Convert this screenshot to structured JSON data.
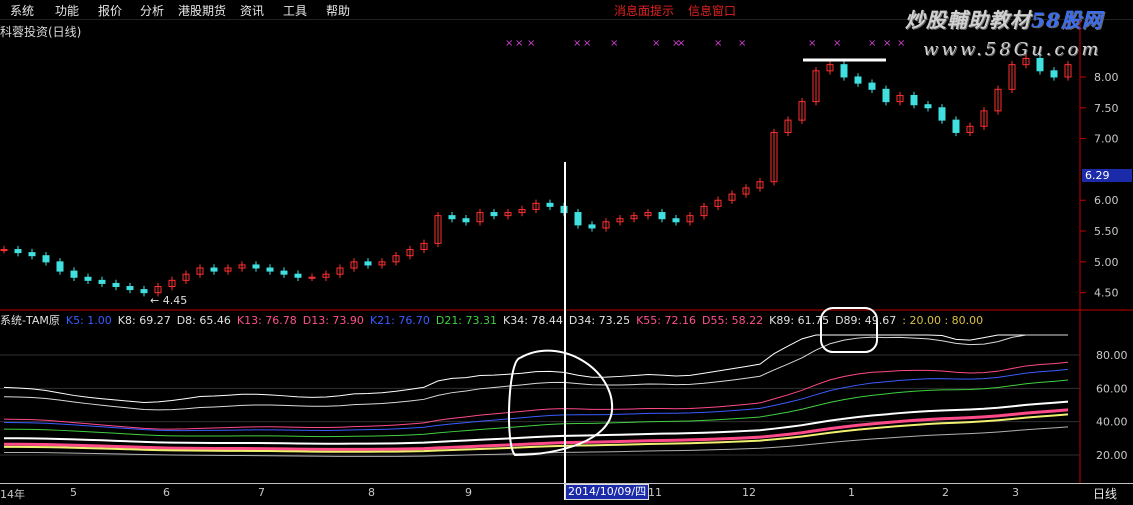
{
  "menu": {
    "items": [
      "系统",
      "功能",
      "报价",
      "分析",
      "港股期货",
      "资讯",
      "工具",
      "帮助"
    ],
    "red_items": [
      "消息面提示",
      "信息窗口"
    ]
  },
  "chart_title": "科蓉投资(日线)",
  "watermark": {
    "line1_pre": "炒股輔助教材",
    "line1_brand": "58股网",
    "line2": "www.58Gu.com"
  },
  "main_axis_labels": [
    "8.00",
    "7.50",
    "7.00",
    "6.00",
    "5.50",
    "5.00",
    "4.50"
  ],
  "current_price": "6.29",
  "low_annotation": "4.45",
  "indicator_caption": [
    {
      "text": "系统-TAM原",
      "color": "#e0e0e0"
    },
    {
      "text": "K5: 1.00",
      "color": "#3a5cff"
    },
    {
      "text": "K8: 69.27",
      "color": "#e0e0e0"
    },
    {
      "text": "D8: 65.46",
      "color": "#e0e0e0"
    },
    {
      "text": "K13: 76.78",
      "color": "#ff5090"
    },
    {
      "text": "D13: 73.90",
      "color": "#ff5090"
    },
    {
      "text": "K21: 76.70",
      "color": "#3a5cff"
    },
    {
      "text": "D21: 73.31",
      "color": "#40d040"
    },
    {
      "text": "K34: 78.44",
      "color": "#e0e0e0"
    },
    {
      "text": "D34: 73.25",
      "color": "#e0e0e0"
    },
    {
      "text": "K55: 72.16",
      "color": "#ff5090"
    },
    {
      "text": "D55: 58.22",
      "color": "#ff5090"
    },
    {
      "text": "K89: 61.75",
      "color": "#e0e0e0"
    },
    {
      "text": "D89: 49.67",
      "color": "#e0e0e0"
    },
    {
      "text": ": 20.00 : 80.00",
      "color": "#d8c040"
    }
  ],
  "indicator_axis_labels": [
    "80.00",
    "60.00",
    "40.00",
    "20.00"
  ],
  "bottom_axis_labels": [
    "14年",
    "5",
    "6",
    "7",
    "8",
    "9",
    "11",
    "12",
    "1",
    "2",
    "3"
  ],
  "date_badge": "2014/10/09/四",
  "period": "日线",
  "colors": {
    "up": "#ff3030",
    "down": "#40e0e0",
    "axis": "#c00000",
    "cursor": "#ffffff"
  },
  "chart_data": {
    "type": "candlestick",
    "title": "科蓉投资(日线)",
    "price_ylim": [
      4.3,
      8.6
    ],
    "price_ticks": [
      4.5,
      5.0,
      5.5,
      6.0,
      7.0,
      7.5,
      8.0
    ],
    "current_price": 6.29,
    "low_marker": 4.45,
    "close_series_approx": [
      5.2,
      5.15,
      5.1,
      5.0,
      4.85,
      4.75,
      4.7,
      4.65,
      4.6,
      4.55,
      4.5,
      4.6,
      4.7,
      4.8,
      4.9,
      4.85,
      4.9,
      4.95,
      4.9,
      4.85,
      4.8,
      4.75,
      4.75,
      4.8,
      4.9,
      5.0,
      4.95,
      5.0,
      5.1,
      5.2,
      5.3,
      5.75,
      5.7,
      5.65,
      5.8,
      5.75,
      5.8,
      5.85,
      5.95,
      5.9,
      5.8,
      5.6,
      5.55,
      5.65,
      5.7,
      5.75,
      5.8,
      5.7,
      5.65,
      5.75,
      5.9,
      6.0,
      6.1,
      6.2,
      6.3,
      7.1,
      7.3,
      7.6,
      8.1,
      8.2,
      8.0,
      7.9,
      7.8,
      7.6,
      7.7,
      7.55,
      7.5,
      7.3,
      7.1,
      7.2,
      7.45,
      7.8,
      8.2,
      8.3,
      8.1,
      8.0,
      8.2
    ],
    "indicator_ylim": [
      5,
      95
    ],
    "indicator_ticks": [
      80,
      60,
      40,
      20
    ],
    "indicator_levels": [
      20,
      80
    ],
    "indicator_values": {
      "K5": 1.0,
      "K8": 69.27,
      "D8": 65.46,
      "K13": 76.78,
      "D13": 73.9,
      "K21": 76.7,
      "D21": 73.31,
      "K34": 78.44,
      "D34": 73.25,
      "K55": 72.16,
      "D55": 58.22,
      "K89": 61.75,
      "D89": 49.67
    },
    "x_months": [
      "14年",
      "5",
      "6",
      "7",
      "8",
      "9",
      "11",
      "12",
      "1",
      "2",
      "3"
    ],
    "cursor_date": "2014/10/09/四"
  }
}
